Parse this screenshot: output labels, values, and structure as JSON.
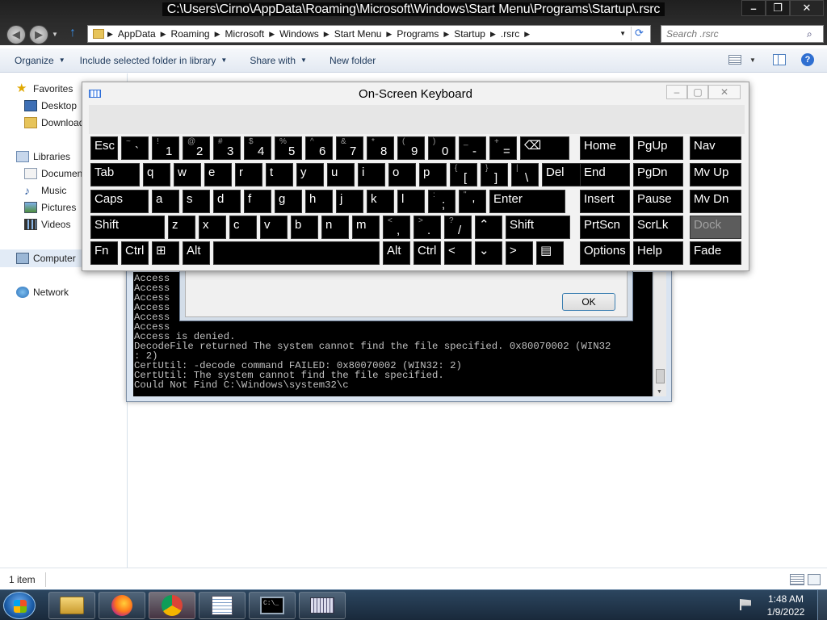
{
  "explorer": {
    "title": "C:\\Users\\Cirno\\AppData\\Roaming\\Microsoft\\Windows\\Start Menu\\Programs\\Startup\\.rsrc",
    "breadcrumbs": [
      "AppData",
      "Roaming",
      "Microsoft",
      "Windows",
      "Start Menu",
      "Programs",
      "Startup",
      ".rsrc"
    ],
    "search_placeholder": "Search .rsrc",
    "toolbar": {
      "organize": "Organize",
      "include": "Include selected folder in library",
      "share": "Share with",
      "new_folder": "New folder"
    },
    "nav": {
      "favorites": "Favorites",
      "desktop": "Desktop",
      "downloads": "Downloads",
      "libraries": "Libraries",
      "documents": "Documents",
      "music": "Music",
      "pictures": "Pictures",
      "videos": "Videos",
      "computer": "Computer",
      "network": "Network"
    },
    "status": "1 item"
  },
  "cmd": {
    "lines": [
      "Access",
      "Access",
      "Access",
      "Access",
      "Access",
      "Access",
      "Access is denied.",
      "DecodeFile returned The system cannot find the file specified. 0x80070002 (WIN32",
      ": 2)",
      "CertUtil: -decode command FAILED: 0x80070002 (WIN32: 2)",
      "CertUtil: The system cannot find the file specified.",
      "Could Not Find C:\\Windows\\system32\\c"
    ]
  },
  "dialog": {
    "ok_label": "OK"
  },
  "osk": {
    "title": "On-Screen Keyboard",
    "rows": [
      [
        {
          "id": "esc",
          "label": "Esc"
        },
        {
          "id": "backtick",
          "shift": "~",
          "label": "`"
        },
        {
          "id": "1",
          "shift": "!",
          "label": "1"
        },
        {
          "id": "2",
          "shift": "@",
          "label": "2"
        },
        {
          "id": "3",
          "shift": "#",
          "label": "3"
        },
        {
          "id": "4",
          "shift": "$",
          "label": "4"
        },
        {
          "id": "5",
          "shift": "%",
          "label": "5"
        },
        {
          "id": "6",
          "shift": "^",
          "label": "6"
        },
        {
          "id": "7",
          "shift": "&",
          "label": "7"
        },
        {
          "id": "8",
          "shift": "*",
          "label": "8"
        },
        {
          "id": "9",
          "shift": "(",
          "label": "9"
        },
        {
          "id": "0",
          "shift": ")",
          "label": "0"
        },
        {
          "id": "minus",
          "shift": "_",
          "label": "-"
        },
        {
          "id": "equals",
          "shift": "+",
          "label": "="
        },
        {
          "id": "backspace",
          "label": "⌫"
        }
      ],
      [
        {
          "id": "tab",
          "label": "Tab"
        },
        {
          "id": "q",
          "label": "q"
        },
        {
          "id": "w",
          "label": "w"
        },
        {
          "id": "e",
          "label": "e"
        },
        {
          "id": "r",
          "label": "r"
        },
        {
          "id": "t",
          "label": "t"
        },
        {
          "id": "y",
          "label": "y"
        },
        {
          "id": "u",
          "label": "u"
        },
        {
          "id": "i",
          "label": "i"
        },
        {
          "id": "o",
          "label": "o"
        },
        {
          "id": "p",
          "label": "p"
        },
        {
          "id": "lbracket",
          "shift": "{",
          "label": "["
        },
        {
          "id": "rbracket",
          "shift": "}",
          "label": "]"
        },
        {
          "id": "backslash",
          "shift": "|",
          "label": "\\"
        },
        {
          "id": "del",
          "label": "Del"
        }
      ],
      [
        {
          "id": "caps",
          "label": "Caps"
        },
        {
          "id": "a",
          "label": "a"
        },
        {
          "id": "s",
          "label": "s"
        },
        {
          "id": "d",
          "label": "d"
        },
        {
          "id": "f",
          "label": "f"
        },
        {
          "id": "g",
          "label": "g"
        },
        {
          "id": "h",
          "label": "h"
        },
        {
          "id": "j",
          "label": "j"
        },
        {
          "id": "k",
          "label": "k"
        },
        {
          "id": "l",
          "label": "l"
        },
        {
          "id": "semicolon",
          "shift": ":",
          "label": ";"
        },
        {
          "id": "quote",
          "shift": "\"",
          "label": "'"
        },
        {
          "id": "enter",
          "label": "Enter"
        }
      ],
      [
        {
          "id": "shift-left",
          "label": "Shift"
        },
        {
          "id": "z",
          "label": "z"
        },
        {
          "id": "x",
          "label": "x"
        },
        {
          "id": "c",
          "label": "c"
        },
        {
          "id": "v",
          "label": "v"
        },
        {
          "id": "b",
          "label": "b"
        },
        {
          "id": "n",
          "label": "n"
        },
        {
          "id": "m",
          "label": "m"
        },
        {
          "id": "comma",
          "shift": "<",
          "label": ","
        },
        {
          "id": "period",
          "shift": ">",
          "label": "."
        },
        {
          "id": "slash",
          "shift": "?",
          "label": "/"
        },
        {
          "id": "up",
          "label": "⌃"
        },
        {
          "id": "shift-right",
          "label": "Shift"
        }
      ],
      [
        {
          "id": "fn",
          "label": "Fn"
        },
        {
          "id": "ctrl-left",
          "label": "Ctrl"
        },
        {
          "id": "win",
          "label": "⊞"
        },
        {
          "id": "alt-left",
          "label": "Alt"
        },
        {
          "id": "space",
          "label": ""
        },
        {
          "id": "alt-right",
          "label": "Alt"
        },
        {
          "id": "ctrl-right",
          "label": "Ctrl"
        },
        {
          "id": "left",
          "label": "<"
        },
        {
          "id": "down",
          "label": "⌄"
        },
        {
          "id": "right",
          "label": ">"
        },
        {
          "id": "menu",
          "label": "▤"
        }
      ]
    ],
    "side_keys": [
      [
        {
          "id": "home",
          "label": "Home"
        },
        {
          "id": "pgup",
          "label": "PgUp"
        },
        {
          "id": "nav",
          "label": "Nav"
        }
      ],
      [
        {
          "id": "end",
          "label": "End"
        },
        {
          "id": "pgdn",
          "label": "PgDn"
        },
        {
          "id": "mvup",
          "label": "Mv Up"
        }
      ],
      [
        {
          "id": "insert",
          "label": "Insert"
        },
        {
          "id": "pause",
          "label": "Pause"
        },
        {
          "id": "mvdn",
          "label": "Mv Dn"
        }
      ],
      [
        {
          "id": "prtscn",
          "label": "PrtScn"
        },
        {
          "id": "scrlk",
          "label": "ScrLk"
        },
        {
          "id": "dock",
          "label": "Dock",
          "disabled": true
        }
      ],
      [
        {
          "id": "options",
          "label": "Options"
        },
        {
          "id": "help",
          "label": "Help"
        },
        {
          "id": "fade",
          "label": "Fade"
        }
      ]
    ]
  },
  "taskbar": {
    "time": "1:48 AM",
    "date": "1/9/2022"
  }
}
